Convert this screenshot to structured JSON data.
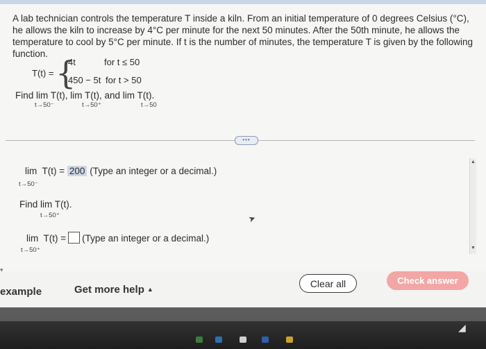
{
  "problem": {
    "text": "A lab technician controls the temperature T inside a kiln. From an initial temperature of 0 degrees Celsius (°C), he allows the kiln to increase by 4°C per minute for the next 50 minutes. After the 50th minute, he allows the temperature to cool by 5°C per minute. If t is the number of minutes, the temperature T is given by the following function.",
    "function_lhs": "T(t) =",
    "case1_expr": "4t",
    "case1_cond": "for t ≤ 50",
    "case2_expr": "450 − 5t",
    "case2_cond": "for t > 50",
    "find_text": "Find  lim  T(t),  lim  T(t), and  lim  T(t).",
    "find_sub1": "t→50⁻",
    "find_sub2": "t→50⁺",
    "find_sub3": "t→50"
  },
  "divider_handle": "•••",
  "answer1": {
    "lim": "lim",
    "expr": "T(t) =",
    "value": "200",
    "hint": "(Type an integer or a decimal.)",
    "sub": "t→50⁻"
  },
  "find2": {
    "text": "Find  lim  T(t).",
    "sub": "t→50⁺"
  },
  "answer2": {
    "lim": "lim",
    "expr": "T(t) =",
    "value": "",
    "hint": "(Type an integer or a decimal.)",
    "sub": "t→50⁺"
  },
  "footer": {
    "example_label": "example",
    "help_label": "Get more help",
    "clear_label": "Clear all",
    "check_label": "Check answer"
  },
  "colors": {
    "check_button": "#f3a6a6",
    "answer_highlight": "#cfd7e6"
  }
}
